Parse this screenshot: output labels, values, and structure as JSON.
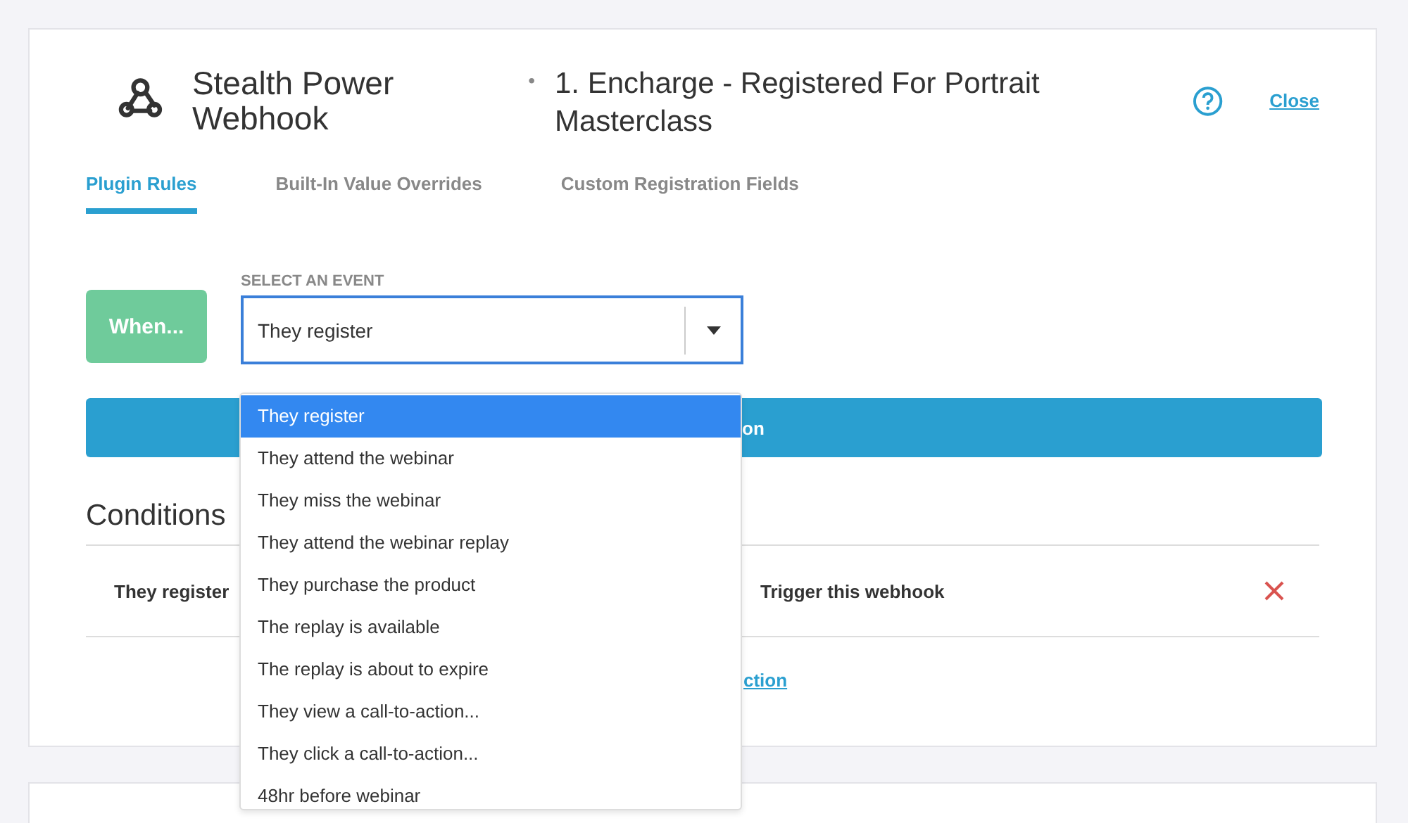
{
  "header": {
    "bullet": "•",
    "title": "Stealth Power Webhook",
    "subtitle": "1. Encharge - Registered For Portrait Masterclass",
    "close": "Close"
  },
  "tabs": [
    {
      "label": "Plugin Rules",
      "selected": true
    },
    {
      "label": "Built-In Value Overrides",
      "selected": false
    },
    {
      "label": "Custom Registration Fields",
      "selected": false
    }
  ],
  "event": {
    "when": "When...",
    "label": "SELECT AN EVENT",
    "value": "They register"
  },
  "action_bar": {
    "label": "on"
  },
  "conditions": {
    "heading": "Conditions",
    "rows": [
      {
        "event": "They register",
        "action": "Trigger this webhook"
      }
    ],
    "link": "ction"
  },
  "dropdown": [
    {
      "label": "They register",
      "selected": true
    },
    {
      "label": "They attend the webinar",
      "selected": false
    },
    {
      "label": "They miss the webinar",
      "selected": false
    },
    {
      "label": "They attend the webinar replay",
      "selected": false
    },
    {
      "label": "They purchase the product",
      "selected": false
    },
    {
      "label": "The replay is available",
      "selected": false
    },
    {
      "label": "The replay is about to expire",
      "selected": false
    },
    {
      "label": "They view a call-to-action...",
      "selected": false
    },
    {
      "label": "They click a call-to-action...",
      "selected": false
    },
    {
      "label": "48hr before webinar",
      "selected": false
    }
  ]
}
